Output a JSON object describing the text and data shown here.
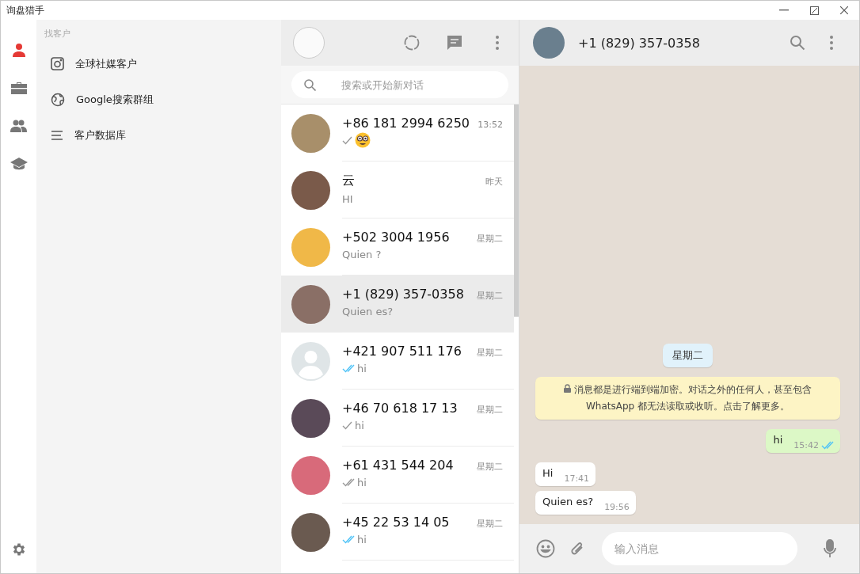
{
  "window": {
    "title": "询盘猎手"
  },
  "rail": [
    {
      "kind": "person",
      "selected": true
    },
    {
      "kind": "briefcase",
      "selected": false
    },
    {
      "kind": "people",
      "selected": false
    },
    {
      "kind": "graduation",
      "selected": false
    }
  ],
  "nav": {
    "heading": "找客户",
    "items": [
      {
        "kind": "instagram",
        "label": "全球社媒客户"
      },
      {
        "kind": "globe",
        "label": "Google搜索群组"
      },
      {
        "kind": "list",
        "label": "客户数据库"
      }
    ]
  },
  "chat_list": {
    "search": {
      "placeholder": "搜索或开始新对话"
    },
    "chats": [
      {
        "kind": "emoji",
        "name": "+86 181 2994 6250",
        "time": "13:52",
        "receipt": {
          "kind": "sent"
        },
        "avatar": {
          "kind": "photo"
        },
        "selected": false
      },
      {
        "kind": "text",
        "name": "云",
        "time": "昨天",
        "preview": "HI",
        "avatar": {
          "kind": "photo"
        },
        "selected": false
      },
      {
        "kind": "text",
        "name": "+502 3004 1956",
        "time": "星期二",
        "preview": "Quien ?",
        "avatar": {
          "kind": "photo"
        },
        "selected": false
      },
      {
        "kind": "text",
        "name": "+1 (829) 357-0358",
        "time": "星期二",
        "preview": "Quien es?",
        "avatar": {
          "kind": "photo"
        },
        "selected": true
      },
      {
        "kind": "text",
        "name": "+421 907 511 176",
        "time": "星期二",
        "preview": "hi",
        "receipt": {
          "kind": "read"
        },
        "avatar": {
          "kind": "default"
        },
        "selected": false
      },
      {
        "kind": "text",
        "name": "+46 70 618 17 13",
        "time": "星期二",
        "preview": "hi",
        "receipt": {
          "kind": "sent"
        },
        "avatar": {
          "kind": "photo"
        },
        "selected": false
      },
      {
        "kind": "text",
        "name": "+61 431 544 204",
        "time": "星期二",
        "preview": "hi",
        "receipt": {
          "kind": "delivered"
        },
        "avatar": {
          "kind": "photo"
        },
        "selected": false
      },
      {
        "kind": "text",
        "name": "+45 22 53 14 05",
        "time": "星期二",
        "preview": "hi",
        "receipt": {
          "kind": "read"
        },
        "avatar": {
          "kind": "photo"
        },
        "selected": false
      }
    ]
  },
  "conversation": {
    "contact": "+1 (829) 357-0358",
    "date_chip": "星期二",
    "notice": "消息都是进行端到端加密。对话之外的任何人，甚至包含 WhatsApp 都无法读取或收听。点击了解更多。",
    "messages": [
      {
        "kind": "out",
        "text": "hi",
        "time": "15:42",
        "receipt": {
          "kind": "read"
        }
      },
      {
        "kind": "in",
        "text": "Hi",
        "time": "17:41"
      },
      {
        "kind": "in",
        "text": "Quien es?",
        "time": "19:56"
      }
    ],
    "composer": {
      "placeholder": "输入消息"
    }
  }
}
